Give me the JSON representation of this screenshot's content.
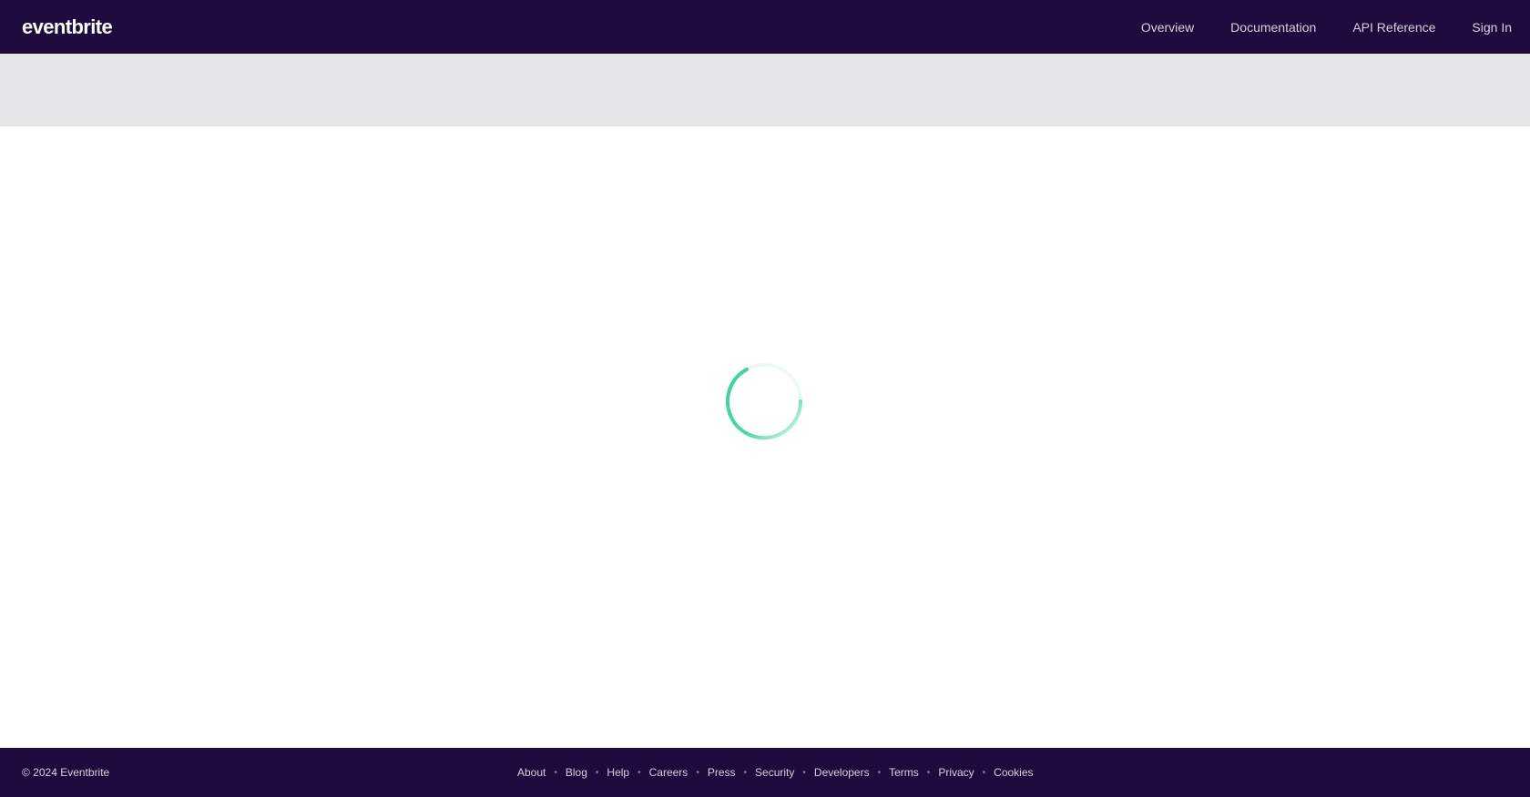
{
  "header": {
    "logo": "eventbrite",
    "nav": [
      {
        "label": "Overview"
      },
      {
        "label": "Documentation"
      },
      {
        "label": "API Reference"
      },
      {
        "label": "Sign In"
      }
    ]
  },
  "loading": {
    "spinner_color": "#3ad29f"
  },
  "footer": {
    "copyright": "© 2024 Eventbrite",
    "links": [
      {
        "label": "About"
      },
      {
        "label": "Blog"
      },
      {
        "label": "Help"
      },
      {
        "label": "Careers"
      },
      {
        "label": "Press"
      },
      {
        "label": "Security"
      },
      {
        "label": "Developers"
      },
      {
        "label": "Terms"
      },
      {
        "label": "Privacy"
      },
      {
        "label": "Cookies"
      }
    ],
    "separator": "•"
  },
  "colors": {
    "brand_dark": "#1e0a3c",
    "banner_grey": "#e4e5e7",
    "spinner": "#3ad29f"
  }
}
